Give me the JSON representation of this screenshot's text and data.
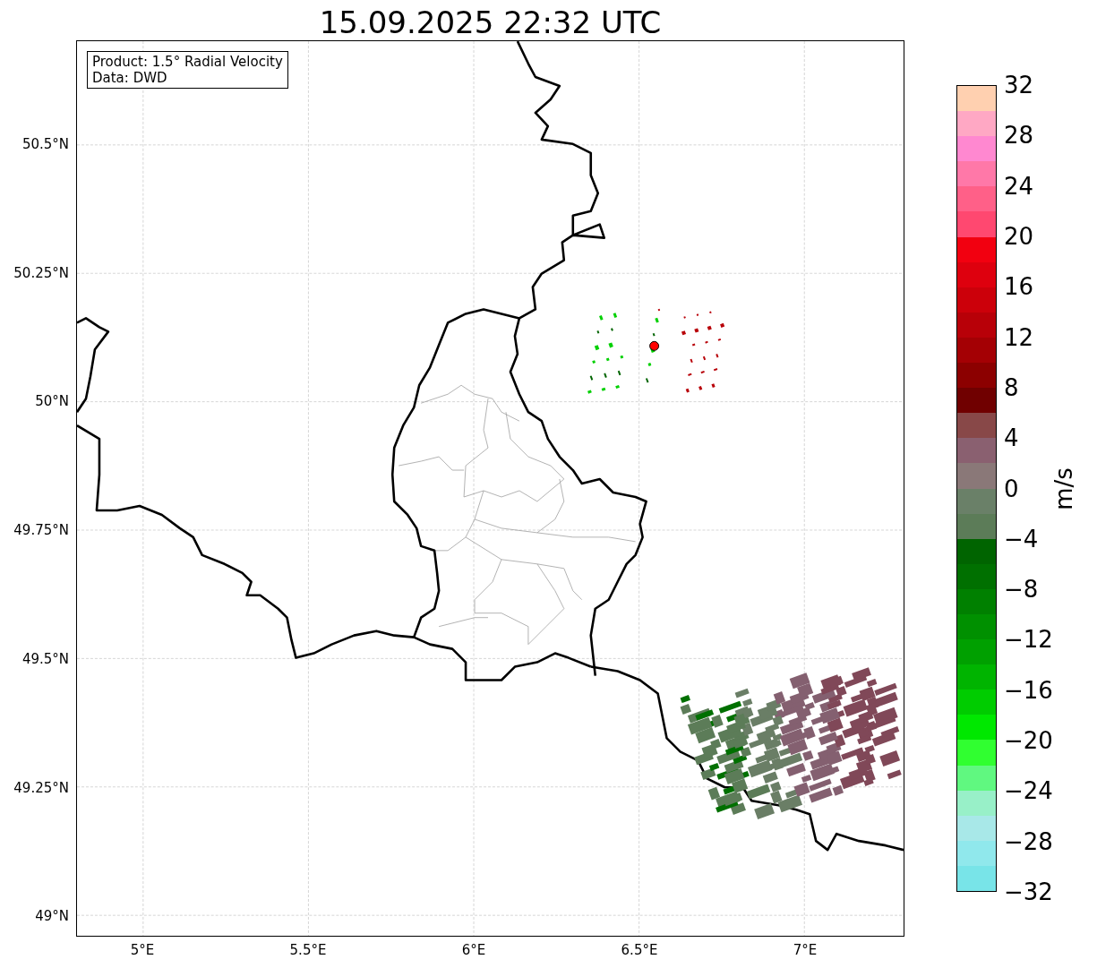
{
  "title": "15.09.2025 22:32 UTC",
  "map": {
    "info_box": [
      "Product: 1.5° Radial Velocity",
      "Data: DWD"
    ],
    "y_ticks": [
      "50.5°N",
      "50.25°N",
      "50°N",
      "49.75°N",
      "49.5°N",
      "49.25°N",
      "49°N"
    ],
    "x_ticks": [
      "5°E",
      "5.5°E",
      "6°E",
      "6.5°E",
      "7°E"
    ]
  },
  "colorbar": {
    "label": "m/s",
    "ticks": [
      "32",
      "28",
      "24",
      "20",
      "16",
      "12",
      "8",
      "4",
      "0",
      "−4",
      "−8",
      "−12",
      "−16",
      "−20",
      "−24",
      "−28",
      "−32"
    ],
    "segments": [
      {
        "color": "#ffd0b0"
      },
      {
        "color": "#ffa8c4"
      },
      {
        "color": "#ff88d0"
      },
      {
        "color": "#ff78a8"
      },
      {
        "color": "#ff6088"
      },
      {
        "color": "#ff4870"
      },
      {
        "color": "#f20010"
      },
      {
        "color": "#de000e"
      },
      {
        "color": "#cc000a"
      },
      {
        "color": "#b80008"
      },
      {
        "color": "#a40004"
      },
      {
        "color": "#8c0000"
      },
      {
        "color": "#700000"
      },
      {
        "color": "#884848"
      },
      {
        "color": "#8a6070"
      },
      {
        "color": "#8a7878"
      },
      {
        "color": "#6a8068"
      },
      {
        "color": "#5c7c58"
      },
      {
        "color": "#006400"
      },
      {
        "color": "#007000"
      },
      {
        "color": "#008000"
      },
      {
        "color": "#009000"
      },
      {
        "color": "#00a000"
      },
      {
        "color": "#00b400"
      },
      {
        "color": "#00cc00"
      },
      {
        "color": "#00e800"
      },
      {
        "color": "#30ff30"
      },
      {
        "color": "#60f880"
      },
      {
        "color": "#98f0c8"
      },
      {
        "color": "#a8e8e8"
      },
      {
        "color": "#90e8ec"
      },
      {
        "color": "#78e4e8"
      }
    ]
  }
}
